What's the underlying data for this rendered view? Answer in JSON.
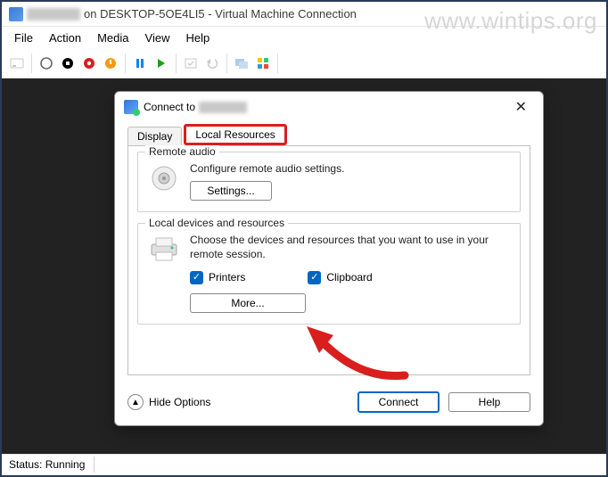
{
  "window": {
    "title_suffix": "on DESKTOP-5OE4LI5 - Virtual Machine Connection"
  },
  "menubar": [
    "File",
    "Action",
    "Media",
    "View",
    "Help"
  ],
  "dialog": {
    "title_prefix": "Connect to",
    "tabs": {
      "display": "Display",
      "local": "Local Resources"
    },
    "audio": {
      "group": "Remote audio",
      "desc": "Configure remote audio settings.",
      "btn": "Settings..."
    },
    "devices": {
      "group": "Local devices and resources",
      "desc": "Choose the devices and resources that you want to use in your remote session.",
      "printers": "Printers",
      "clipboard": "Clipboard",
      "more": "More..."
    },
    "hide": "Hide Options",
    "connect": "Connect",
    "help": "Help"
  },
  "status": "Status: Running",
  "watermark": "www.wintips.org"
}
